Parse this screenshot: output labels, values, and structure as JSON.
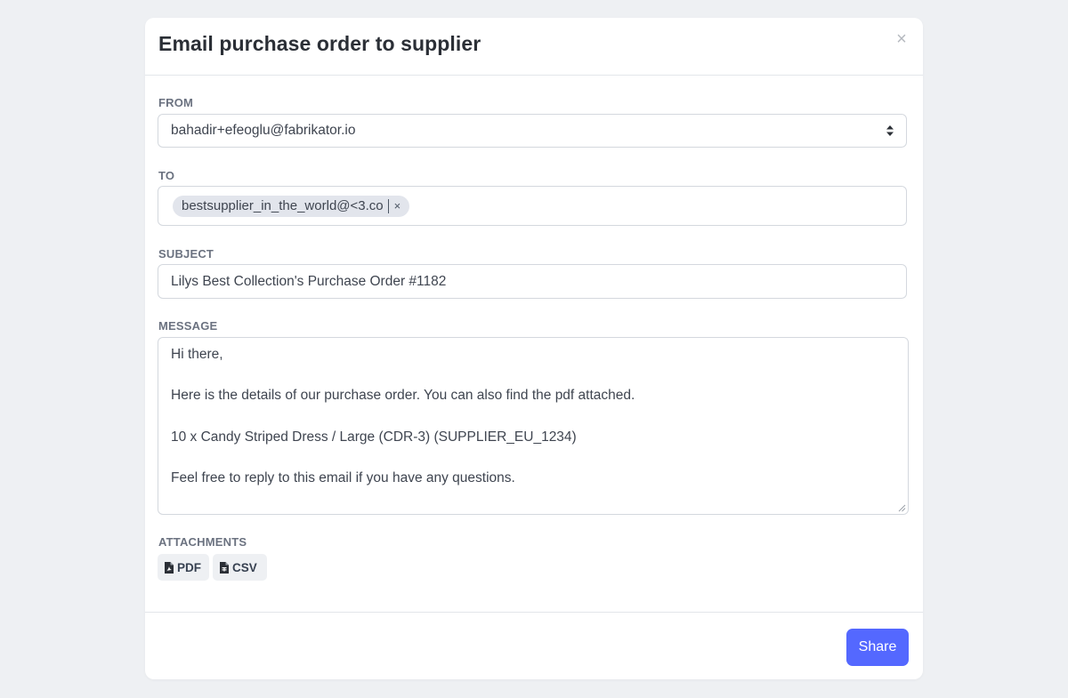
{
  "modal": {
    "title": "Email purchase order to supplier",
    "close_glyph": "×"
  },
  "from": {
    "label": "FROM",
    "value": "bahadir+efeoglu@fabrikator.io"
  },
  "to": {
    "label": "TO",
    "recipients": [
      {
        "email": "bestsupplier_in_the_world@<3.co",
        "remove_glyph": "×"
      }
    ]
  },
  "subject": {
    "label": "SUBJECT",
    "value": "Lilys Best Collection's Purchase Order #1182"
  },
  "message": {
    "label": "MESSAGE",
    "lines": [
      "Hi there,",
      "Here is the details of our purchase order. You can also find the pdf attached.",
      "10 x Candy Striped Dress / Large (CDR-3) (SUPPLIER_EU_1234)",
      "Feel free to reply to this email if you have any questions."
    ]
  },
  "attachments": {
    "label": "ATTACHMENTS",
    "items": [
      {
        "label": "PDF",
        "icon": "file-pdf-icon"
      },
      {
        "label": "CSV",
        "icon": "file-csv-icon"
      }
    ]
  },
  "actions": {
    "share_label": "Share"
  },
  "colors": {
    "page_bg": "#eef0f3",
    "accent": "#5468ff",
    "tag_bg": "#e2e5ec"
  }
}
